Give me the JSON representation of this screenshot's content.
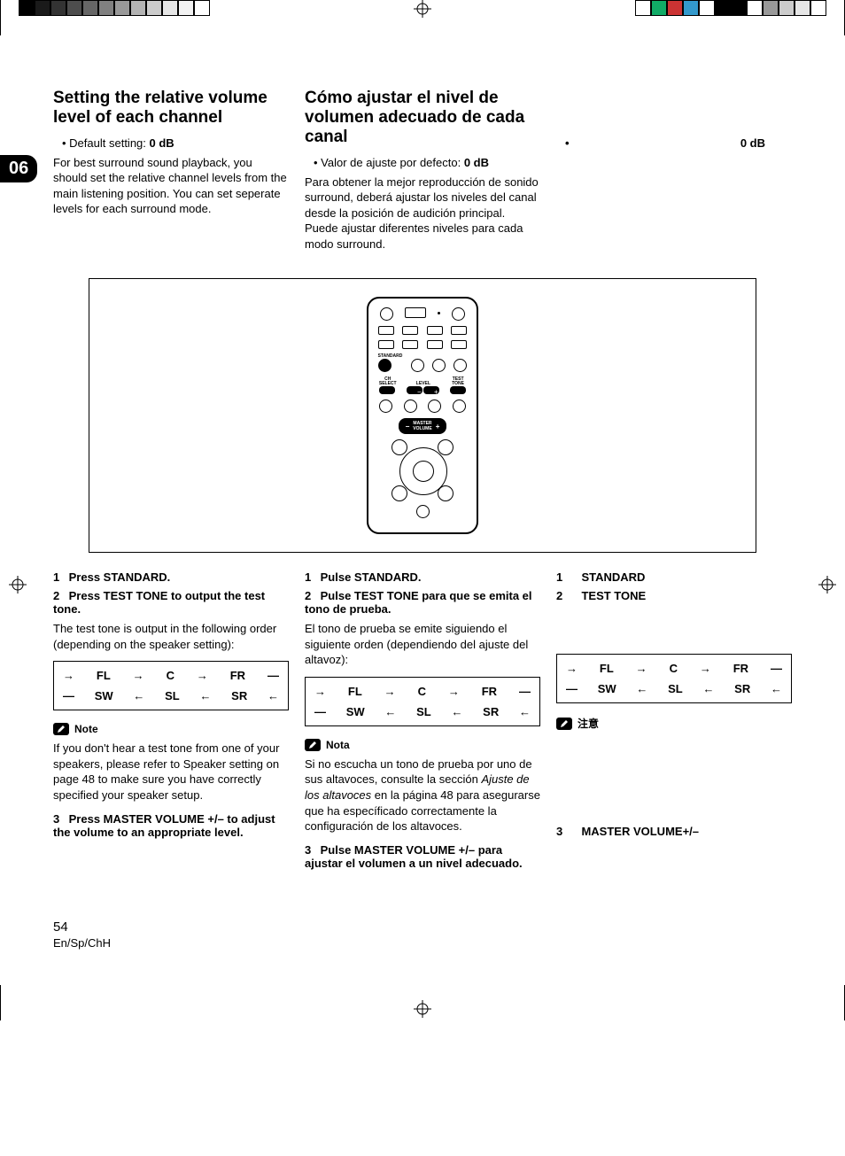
{
  "chapter_number": "06",
  "page_number": "54",
  "footer_lang": "En/Sp/ChH",
  "remote_labels": {
    "standard": "STANDARD",
    "ch_select": "CH\nSELECT",
    "level": "LEVEL",
    "test_tone": "TEST\nTONE",
    "master_volume": "MASTER\nVOLUME"
  },
  "flow": {
    "top": [
      "FL",
      "C",
      "FR"
    ],
    "bottom": [
      "SW",
      "SL",
      "SR"
    ]
  },
  "col1": {
    "title": "Setting the relative volume level of each channel",
    "default_label": "Default setting:",
    "default_value": "0 dB",
    "intro": "For best surround sound playback, you should set the relative channel levels from the main listening position. You can set seperate levels for each surround mode.",
    "step1": "Press STANDARD.",
    "step2_title": "Press TEST TONE to output the test tone.",
    "step2_body": "The test tone is output in the following order (depending on the speaker setting):",
    "note_label": "Note",
    "note_body": "If you don't hear a test tone from one of your speakers, please refer to Speaker setting on page 48 to make sure you have correctly specified your speaker setup.",
    "step3": "Press MASTER VOLUME +/– to adjust the volume to an appropriate level."
  },
  "col2": {
    "title": "Cómo ajustar el nivel de volumen adecuado de cada canal",
    "default_label": "Valor de ajuste por defecto:",
    "default_value": "0 dB",
    "intro": "Para obtener la mejor reproducción de sonido surround, deberá ajustar los niveles del canal desde la posición de audición principal. Puede ajustar diferentes niveles para cada modo surround.",
    "step1": "Pulse STANDARD.",
    "step2_title": "Pulse TEST TONE para que se emita el tono de prueba.",
    "step2_body": "El tono de prueba se emite siguiendo el siguiente orden (dependiendo del ajuste del altavoz):",
    "note_label": "Nota",
    "note_body_1": "Si no escucha un tono de prueba por uno de sus altavoces, consulte la sección ",
    "note_body_italic": "Ajuste de los altavoces",
    "note_body_2": " en la página 48 para asegurarse que ha específicado correctamente la configuración de los altavoces.",
    "step3": "Pulse MASTER VOLUME +/– para ajustar el volumen a un nivel adecuado."
  },
  "col3": {
    "default_bullet": "•",
    "default_value": "0 dB",
    "step1_kw": "STANDARD",
    "step2_kw": "TEST TONE",
    "note_label": "注意",
    "step3_kw": "MASTER VOLUME+/–"
  }
}
